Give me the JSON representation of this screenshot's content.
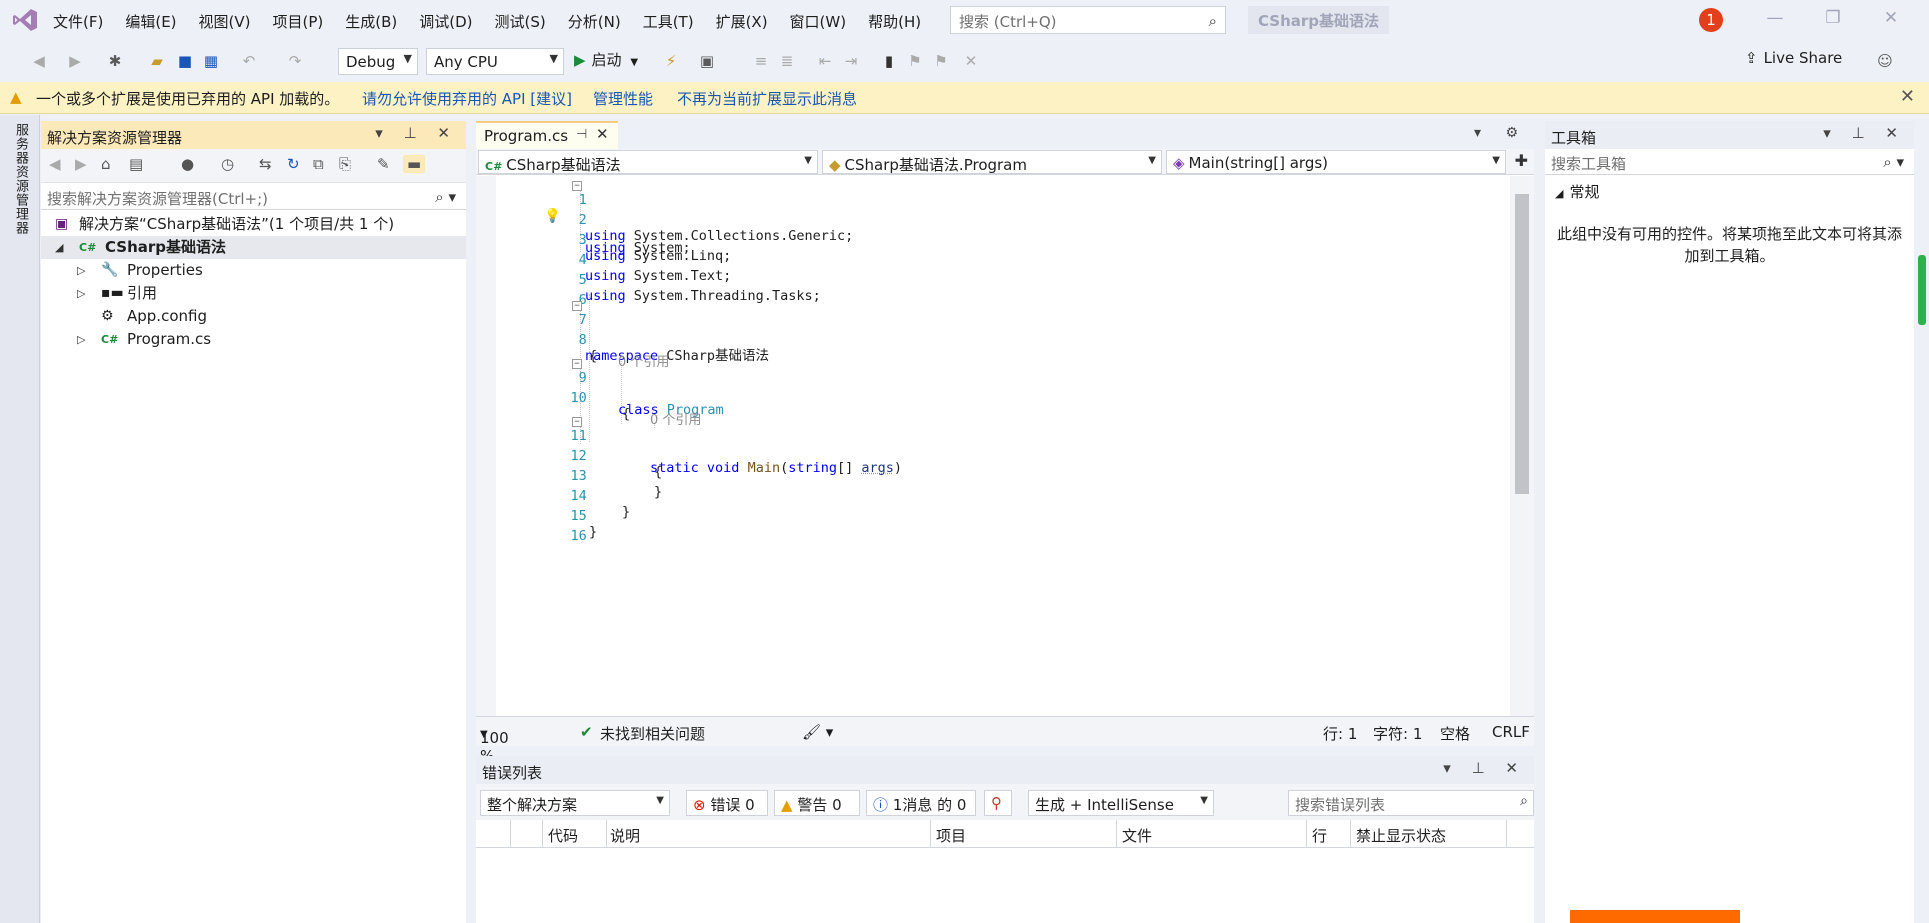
{
  "menu": [
    "文件(F)",
    "编辑(E)",
    "视图(V)",
    "项目(P)",
    "生成(B)",
    "调试(D)",
    "测试(S)",
    "分析(N)",
    "工具(T)",
    "扩展(X)",
    "窗口(W)",
    "帮助(H)"
  ],
  "search": {
    "placeholder": "搜索 (Ctrl+Q)"
  },
  "solution_name": "CSharp基础语法",
  "notification_count": "1",
  "toolbar": {
    "config": "Debug",
    "platform": "Any CPU",
    "start": "启动",
    "live_share": "Live Share"
  },
  "infobar": {
    "message": "一个或多个扩展是使用已弃用的 API 加载的。",
    "link1": "请勿允许使用弃用的 API [建议]",
    "link2": "管理性能",
    "link3": "不再为当前扩展显示此消息"
  },
  "left_strip": {
    "label": "服务器资源管理器"
  },
  "solution_explorer": {
    "title": "解决方案资源管理器",
    "search_placeholder": "搜索解决方案资源管理器(Ctrl+;)",
    "solution_label": "解决方案“CSharp基础语法”(1 个项目/共 1 个)",
    "project_label": "CSharp基础语法",
    "items": [
      "Properties",
      "引用",
      "App.config",
      "Program.cs"
    ]
  },
  "editor": {
    "tab": "Program.cs",
    "nav_project": "CSharp基础语法",
    "nav_class": "CSharp基础语法.Program",
    "nav_member": "Main(string[] args)",
    "code": {
      "l1": "using",
      "l1b": " System;",
      "l2": "using",
      "l2b": " System.Collections.Generic;",
      "l3": "using",
      "l3b": " System.Linq;",
      "l4": "using",
      "l4b": " System.Text;",
      "l5": "using",
      "l5b": " System.Threading.Tasks;",
      "l7": "namespace",
      "l7b": " CSharp基础语法",
      "l8": "{",
      "ref1": "0 个引用",
      "l9": "class",
      "l9b": "Program",
      "l10": "{",
      "ref2": "0 个引用",
      "l11a": "static",
      "l11b": "void",
      "l11c": "Main",
      "l11d": "(",
      "l11e": "string",
      "l11f": "[] ",
      "l11g": "args",
      "l11h": ")",
      "l12": "{",
      "l13": "}",
      "l14": "}",
      "l15": "}"
    },
    "line_numbers": [
      "1",
      "2",
      "3",
      "4",
      "5",
      "6",
      "7",
      "8",
      "9",
      "10",
      "11",
      "12",
      "13",
      "14",
      "15",
      "16"
    ],
    "zoom": "100 %",
    "issues": "未找到相关问题",
    "row": "行: 1",
    "col": "字符: 1",
    "spaces": "空格",
    "eol": "CRLF"
  },
  "error_list": {
    "title": "错误列表",
    "scope": "整个解决方案",
    "errors": "错误 0",
    "warnings": "警告 0",
    "messages": "1消息 的 0",
    "build": "生成 + IntelliSense",
    "search_placeholder": "搜索错误列表",
    "headers": [
      "代码",
      "说明",
      "项目",
      "文件",
      "行",
      "禁止显示状态"
    ]
  },
  "toolbox": {
    "title": "工具箱",
    "search_placeholder": "搜索工具箱",
    "group": "常规",
    "empty_message": "此组中没有可用的控件。将某项拖至此文本可将其添加到工具箱。"
  }
}
